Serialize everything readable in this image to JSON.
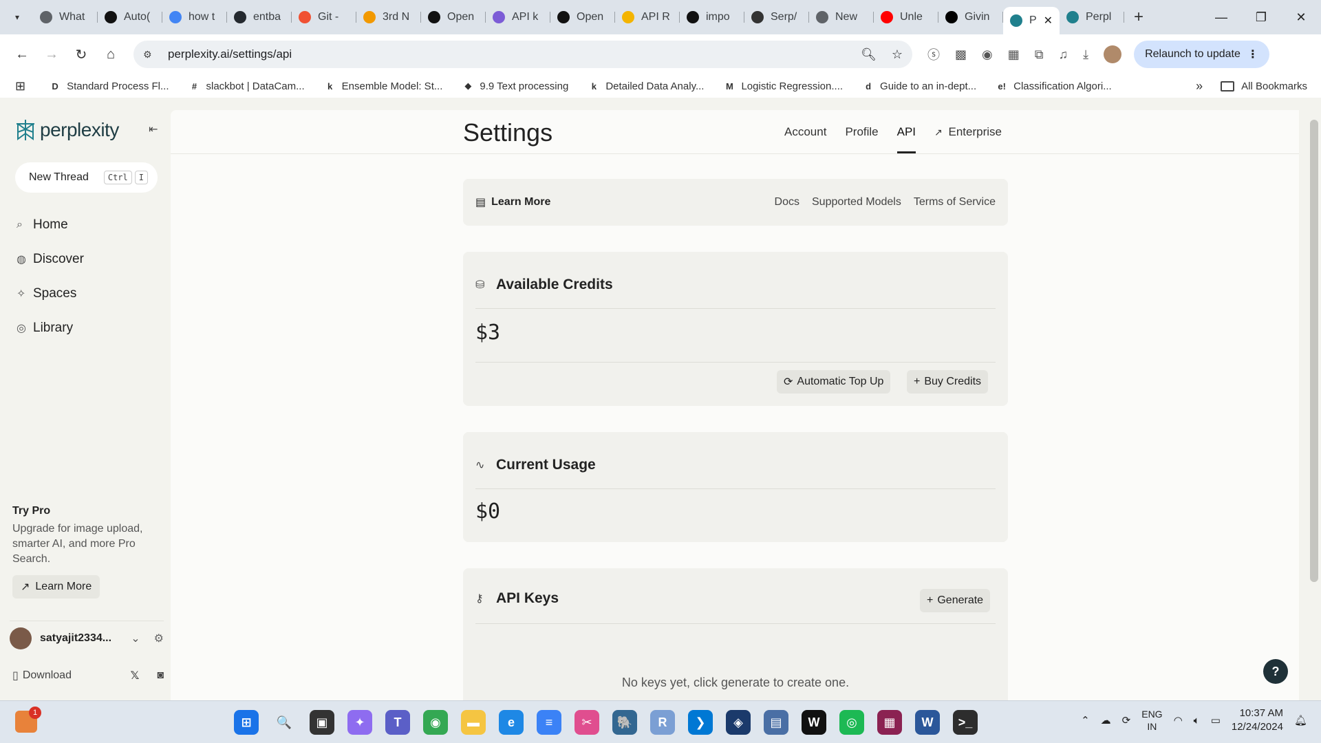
{
  "browser": {
    "tabs": [
      {
        "label": "What",
        "color": "#5f6368"
      },
      {
        "label": "Auto(",
        "color": "#111111"
      },
      {
        "label": "how t",
        "color": "#4285f4"
      },
      {
        "label": "entba",
        "color": "#24292f"
      },
      {
        "label": "Git - ",
        "color": "#f05133"
      },
      {
        "label": "3rd N",
        "color": "#f29900"
      },
      {
        "label": "Open",
        "color": "#111111"
      },
      {
        "label": "API k",
        "color": "#7c5cd6"
      },
      {
        "label": "Open",
        "color": "#111111"
      },
      {
        "label": "API R",
        "color": "#f4b400"
      },
      {
        "label": "impo",
        "color": "#111111"
      },
      {
        "label": "Serp/",
        "color": "#333333"
      },
      {
        "label": "New",
        "color": "#5f6368"
      },
      {
        "label": "Unle",
        "color": "#ff0000"
      },
      {
        "label": "Givin",
        "color": "#000000"
      },
      {
        "label": "P",
        "color": "#20808d"
      },
      {
        "label": "Perpl",
        "color": "#20808d"
      }
    ],
    "active_tab_index": 15,
    "url": "perplexity.ai/settings/api",
    "relaunch_label": "Relaunch to update",
    "bookmarks": [
      {
        "label": "Standard Process Fl...",
        "icon": "D"
      },
      {
        "label": "slackbot | DataCam...",
        "icon": "#"
      },
      {
        "label": "Ensemble Model: St...",
        "icon": "k"
      },
      {
        "label": "9.9 Text processing",
        "icon": "◆"
      },
      {
        "label": "Detailed Data Analy...",
        "icon": "k"
      },
      {
        "label": "Logistic Regression....",
        "icon": "M"
      },
      {
        "label": "Guide to an in-dept...",
        "icon": "d"
      },
      {
        "label": "Classification Algori...",
        "icon": "e!"
      }
    ],
    "all_bookmarks_label": "All Bookmarks"
  },
  "sidebar": {
    "brand": "perplexity",
    "new_thread_label": "New Thread",
    "shortcut_keys": [
      "Ctrl",
      "I"
    ],
    "nav": [
      {
        "label": "Home",
        "icon": "search-icon"
      },
      {
        "label": "Discover",
        "icon": "globe-icon"
      },
      {
        "label": "Spaces",
        "icon": "sparkle-icon"
      },
      {
        "label": "Library",
        "icon": "library-icon"
      }
    ],
    "try_pro_title": "Try Pro",
    "try_pro_text": "Upgrade for image upload, smarter AI, and more Pro Search.",
    "learn_more_label": "Learn More",
    "username": "satyajit2334...",
    "download_label": "Download"
  },
  "settings": {
    "title": "Settings",
    "tabs": [
      {
        "label": "Account"
      },
      {
        "label": "Profile"
      },
      {
        "label": "API"
      },
      {
        "label": "Enterprise"
      }
    ],
    "active_tab": "API",
    "learn_more": {
      "label": "Learn More",
      "links": [
        "Docs",
        "Supported Models",
        "Terms of Service"
      ]
    },
    "credits": {
      "title": "Available Credits",
      "amount": "$3",
      "auto_topup_label": "Automatic Top Up",
      "buy_label": "Buy Credits"
    },
    "usage": {
      "title": "Current Usage",
      "amount": "$0"
    },
    "api_keys": {
      "title": "API Keys",
      "generate_label": "Generate",
      "empty_text": "No keys yet, click generate to create one."
    },
    "help_label": "?"
  },
  "taskbar": {
    "notification_count": "1",
    "lang_line1": "ENG",
    "lang_line2": "IN",
    "time": "10:37 AM",
    "date": "12/24/2024",
    "apps": [
      {
        "name": "windows-start-icon",
        "color": "#1a73e8",
        "glyph": "⊞"
      },
      {
        "name": "search-icon",
        "color": "transparent",
        "glyph": "🔍"
      },
      {
        "name": "task-view-icon",
        "color": "#333333",
        "glyph": "▣"
      },
      {
        "name": "copilot-icon",
        "color": "#8e6cf0",
        "glyph": "✦"
      },
      {
        "name": "teams-icon",
        "color": "#5b5fc7",
        "glyph": "T"
      },
      {
        "name": "chrome-icon",
        "color": "#34a853",
        "glyph": "◉"
      },
      {
        "name": "file-explorer-icon",
        "color": "#f5c542",
        "glyph": "▬"
      },
      {
        "name": "edge-icon",
        "color": "#1e88e5",
        "glyph": "e"
      },
      {
        "name": "notepad-icon",
        "color": "#3b82f6",
        "glyph": "≡"
      },
      {
        "name": "snipping-tool-icon",
        "color": "#e04e8f",
        "glyph": "✂"
      },
      {
        "name": "postgres-icon",
        "color": "#336791",
        "glyph": "🐘"
      },
      {
        "name": "r-icon",
        "color": "#7b9fd4",
        "glyph": "R"
      },
      {
        "name": "vscode-icon",
        "color": "#0078d4",
        "glyph": "❯"
      },
      {
        "name": "netbeans-icon",
        "color": "#1b3a6b",
        "glyph": "◈"
      },
      {
        "name": "chat-icon",
        "color": "#4a6fa5",
        "glyph": "▤"
      },
      {
        "name": "webex-icon",
        "color": "#111111",
        "glyph": "W"
      },
      {
        "name": "spotify-icon",
        "color": "#1db954",
        "glyph": "◎"
      },
      {
        "name": "winrar-icon",
        "color": "#8b2252",
        "glyph": "▦"
      },
      {
        "name": "word-icon",
        "color": "#2b579a",
        "glyph": "W"
      },
      {
        "name": "terminal-icon",
        "color": "#2d2d2d",
        "glyph": ">_"
      }
    ]
  }
}
